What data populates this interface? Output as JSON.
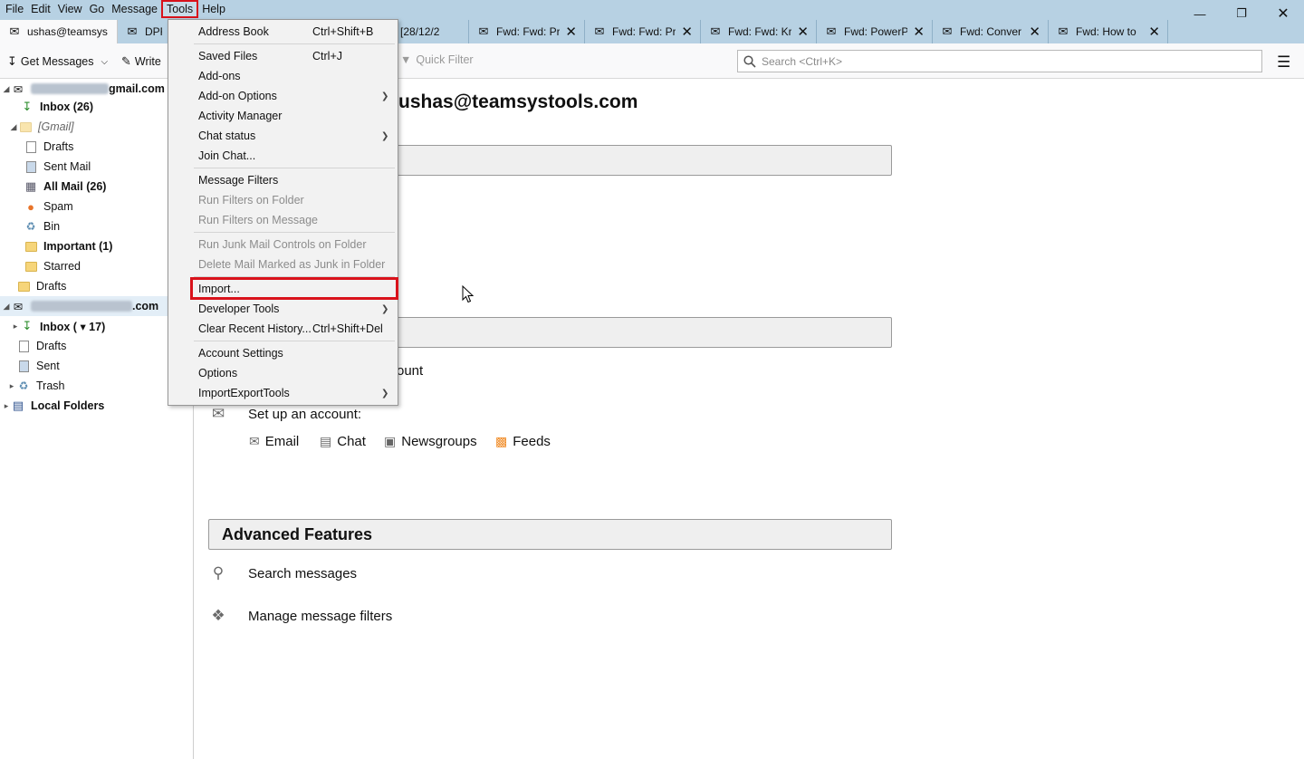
{
  "menubar": {
    "items": [
      "File",
      "Edit",
      "View",
      "Go",
      "Message",
      "Tools",
      "Help"
    ],
    "active": "Tools"
  },
  "tabs": [
    {
      "label": "ushas@teamsys",
      "icon": "account-icon"
    },
    {
      "label": "DPR",
      "icon": "mail-icon"
    },
    {
      "label": "[28/12/2",
      "icon": "mail-icon"
    },
    {
      "label": "Fwd: Fwd: Pr",
      "icon": "mail-icon"
    },
    {
      "label": "Fwd: Fwd: Pr",
      "icon": "mail-icon"
    },
    {
      "label": "Fwd: Fwd: Kr",
      "icon": "mail-icon"
    },
    {
      "label": "Fwd: PowerP",
      "icon": "mail-icon"
    },
    {
      "label": "Fwd: Conver",
      "icon": "mail-icon"
    },
    {
      "label": "Fwd: How to",
      "icon": "mail-icon"
    }
  ],
  "toolbar": {
    "get_messages": "Get Messages",
    "write": "Write",
    "quick_filter": "Quick Filter",
    "search_placeholder": "Search <Ctrl+K>"
  },
  "folders": {
    "gmail_account_suffix": "gmail.com",
    "inbox_gmail": "Inbox (26)",
    "gmail_group": "[Gmail]",
    "drafts1": "Drafts",
    "sent_mail": "Sent Mail",
    "all_mail": "All Mail (26)",
    "spam": "Spam",
    "bin": "Bin",
    "important": "Important (1)",
    "starred": "Starred",
    "drafts2": "Drafts",
    "team_account_suffix": ".com",
    "inbox_team": "Inbox ( ▾ 17)",
    "drafts3": "Drafts",
    "sent": "Sent",
    "trash": "Trash",
    "local_folders": "Local Folders"
  },
  "content": {
    "account_title": "ushas@teamsystools.com",
    "account_fragment": "ount",
    "setup_label": "Set up an account:",
    "links": [
      "Email",
      "Chat",
      "Newsgroups",
      "Feeds"
    ],
    "advanced_title": "Advanced Features",
    "search_messages": "Search messages",
    "manage_filters": "Manage message filters"
  },
  "tools_menu": {
    "address_book": {
      "label": "Address Book",
      "shortcut": "Ctrl+Shift+B"
    },
    "saved_files": {
      "label": "Saved Files",
      "shortcut": "Ctrl+J"
    },
    "addons": "Add-ons",
    "addon_options": "Add-on Options",
    "activity_manager": "Activity Manager",
    "chat_status": "Chat status",
    "join_chat": "Join Chat...",
    "message_filters": "Message Filters",
    "run_filters_folder": "Run Filters on Folder",
    "run_filters_message": "Run Filters on Message",
    "run_junk": "Run Junk Mail Controls on Folder",
    "delete_junk": "Delete Mail Marked as Junk in Folder",
    "import": "Import...",
    "developer_tools": "Developer Tools",
    "clear_history": {
      "label": "Clear Recent History...",
      "shortcut": "Ctrl+Shift+Del"
    },
    "account_settings": "Account Settings",
    "options": "Options",
    "importexport": "ImportExportTools"
  },
  "colors": {
    "titlebar": "#b7d1e3",
    "highlight": "#d9121b"
  }
}
